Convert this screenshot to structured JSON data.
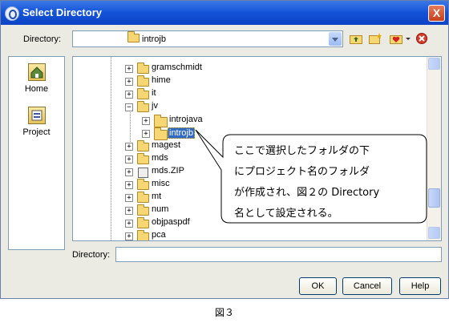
{
  "window": {
    "title": "Select Directory",
    "close_label": "X"
  },
  "directory_bar": {
    "label": "Directory:",
    "value": "introjb"
  },
  "sidebar": {
    "items": [
      {
        "label": "Home"
      },
      {
        "label": "Project"
      }
    ]
  },
  "tree": {
    "expand_glyph": "+",
    "collapse_glyph": "−",
    "nodes": [
      {
        "name": "gramschmidt"
      },
      {
        "name": "hime"
      },
      {
        "name": "it"
      },
      {
        "name": "jv"
      },
      {
        "name": "introjava"
      },
      {
        "name": "introjb"
      },
      {
        "name": "magest"
      },
      {
        "name": "mds"
      },
      {
        "name": "mds.ZIP"
      },
      {
        "name": "misc"
      },
      {
        "name": "mt"
      },
      {
        "name": "num"
      },
      {
        "name": "objpaspdf"
      },
      {
        "name": "pca"
      }
    ]
  },
  "callout": {
    "lines": [
      "ここで選択したフォルダの下",
      "にプロジェクト名のフォルダ",
      "が作成され、図２の Directory",
      "名として設定される。"
    ]
  },
  "directory_field": {
    "label": "Directory:",
    "value": ""
  },
  "buttons": {
    "ok": "OK",
    "cancel": "Cancel",
    "help": "Help"
  },
  "caption": "図３",
  "colors": {
    "titlebar": "#1352d8",
    "selection": "#316ac5",
    "dialog_bg": "#ecebe3"
  }
}
